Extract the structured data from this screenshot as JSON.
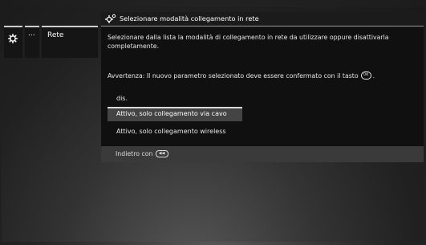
{
  "breadcrumbs": {
    "dots_label": "...",
    "network_label": "Rete"
  },
  "header": {
    "title": "Selezionare modalità collegamento in rete",
    "icon": "gear-icon"
  },
  "dialog": {
    "description": "Selezionare dalla lista la modalità di collegamento in rete da utilizzare oppure disattivarla completamente.",
    "warning_prefix": "Avvertenza: Il nuovo parametro selezionato deve essere confermato con il tasto",
    "warning_suffix": ".",
    "ok_key_label": "OK"
  },
  "options": [
    {
      "label": "dis.",
      "selected": false
    },
    {
      "label": "Attivo, solo collegamento via cavo",
      "selected": true
    },
    {
      "label": "Attivo, solo collegamento wireless",
      "selected": false
    }
  ],
  "footer": {
    "back_label": "Indietro con",
    "back_key_icon": "back-key-icon"
  },
  "colors": {
    "panel_bg": "#101010",
    "selected_bg": "#444444",
    "footer_bg": "#3a3a3a",
    "text": "#e8e8e8"
  }
}
